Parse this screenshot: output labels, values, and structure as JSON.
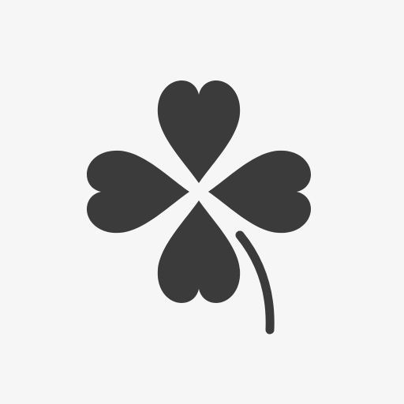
{
  "icon": {
    "name": "four-leaf-clover-icon",
    "fill_color": "#3b3b3b",
    "background_color": "#f6f6f6"
  }
}
